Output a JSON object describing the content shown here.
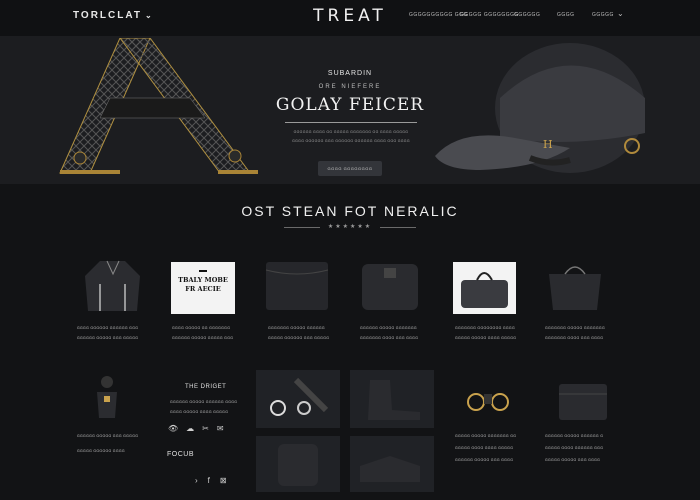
{
  "header": {
    "brand_left": "TORLCLAT",
    "logo": "TREAT",
    "nav": [
      "GGGGGGGGGG GGG",
      "GGGGG GGGGGGGG",
      "GGGGGG",
      "GGGG",
      "GGGGG"
    ]
  },
  "hero": {
    "eyebrow": "SUBARDIN",
    "sub": "ORE NIEFERE",
    "title": "GOLAY FEICER",
    "desc": [
      "GGGGGG GGGG GG GGGGG GGGGGGG GG GGGG GGGGG",
      "GGGG GGGGGG GGG GGGGGG GGGGGG GGGG GGG GGGG"
    ],
    "button": "GGGG GGGGGGGG"
  },
  "section": {
    "title": "OST STEAN FOT NERALIC",
    "stars": "★★★★★★"
  },
  "promo": {
    "line1": "TBALY MOBE",
    "line2": "FR AECIE"
  },
  "products": [
    {
      "l1": "GGGG GGGGGG GGGGGG GGG",
      "l2": "GGGGGG GGGGG GGG GGGGG"
    },
    {
      "l1": "GGGG GGGGG GG GGGGGGG",
      "l2": "GGGGGG GGGGG GGGGG GGG"
    },
    {
      "l1": "GGGGGGG GGGGG GGGGGG",
      "l2": "GGGGG GGGGGG GGG GGGGG"
    },
    {
      "l1": "GGGGGG GGGGG GGGGGGG",
      "l2": "GGGGGGG GGGG GGG GGGG"
    },
    {
      "l1": "GGGGGGG GGGGGGGG GGGG",
      "l2": "GGGGG GGGGG GGGG GGGGG"
    },
    {
      "l1": "GGGGGGG GGGGG GGGGGGG",
      "l2": "GGGGGGG GGGG GGG GGGG"
    }
  ],
  "lower": {
    "left_l1": "GGGGGG GGGGG GGG GGGGG",
    "left_l2": "GGGGG GGGGGG GGGG",
    "mid_title": "THE DRIGET",
    "mid_l1": "GGGGGG GGGGG GGGGGG GGGG",
    "mid_l2": "GGGG GGGGG GGGG GGGGG",
    "mid_social": [
      "👁",
      "☁",
      "✂",
      "✉"
    ],
    "foot_title": "FOCUB",
    "foot_icons": [
      "›",
      "f",
      "⊠"
    ],
    "right1_l1": "GGGGG GGGGG GGGGGGG GG",
    "right1_l2": "GGGGG GGGG GGGG GGGGG",
    "right1_l3": "GGGGGG GGGGG GGG GGGG",
    "right2_l1": "GGGGGG GGGGG GGGGGG G",
    "right2_l2": "GGGGG GGGG GGGGGG GGG",
    "right2_l3": "GGGGG GGGGG GGG GGGG"
  }
}
